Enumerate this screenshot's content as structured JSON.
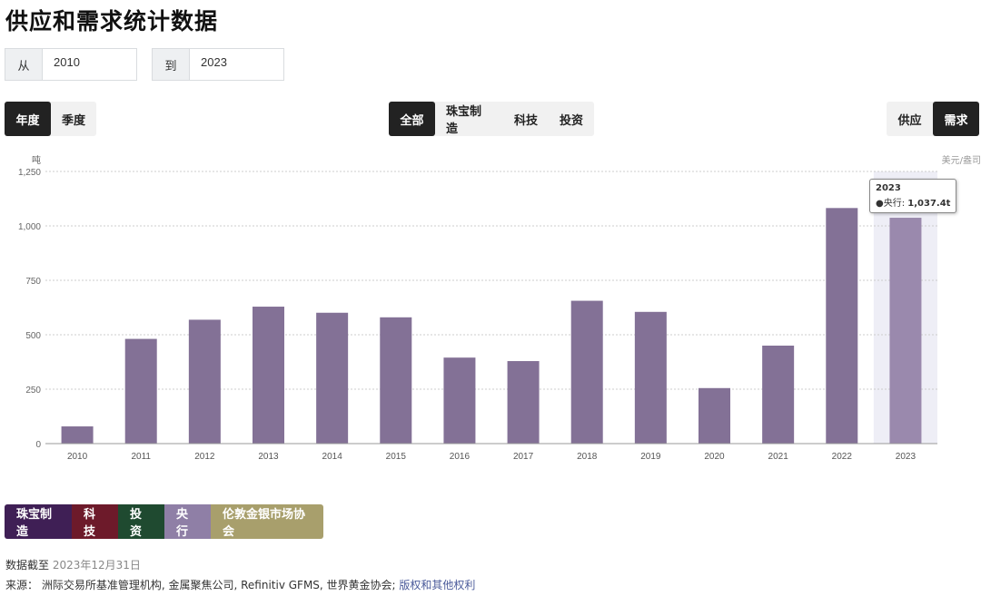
{
  "title": "供应和需求统计数据",
  "range": {
    "from_label": "从",
    "from_value": "2010",
    "to_label": "到",
    "to_value": "2023"
  },
  "period_toggle": {
    "annual": "年度",
    "quarterly": "季度"
  },
  "sector_toggle": {
    "all": "全部",
    "jewellery": "珠宝制造",
    "tech": "科技",
    "investment": "投资"
  },
  "side_toggle": {
    "supply": "供应",
    "demand": "需求"
  },
  "colors": {
    "bar": "#837196",
    "bar_highlight": "#9a89ad",
    "jewellery": "#3f1f55",
    "tech": "#6d1a2a",
    "investment": "#1f4a30",
    "central_banks": "#8f7fa6",
    "lbma": "#a89f6c"
  },
  "chart_data": {
    "type": "bar",
    "categories": [
      "2010",
      "2011",
      "2012",
      "2013",
      "2014",
      "2015",
      "2016",
      "2017",
      "2018",
      "2019",
      "2020",
      "2021",
      "2022",
      "2023"
    ],
    "series": [
      {
        "name": "央行",
        "values": [
          79,
          481,
          569,
          629,
          601,
          580,
          395,
          379,
          656,
          605,
          255,
          450,
          1082,
          1037.4
        ]
      }
    ],
    "ylim": [
      0,
      1250
    ],
    "yticks": [
      "0",
      "250",
      "500",
      "750",
      "1,000",
      "1,250"
    ],
    "ylabel": "吨",
    "y2label": "美元/盎司",
    "grid": true
  },
  "tooltip": {
    "year": "2023",
    "series": "●央行:",
    "value": "1,037.4t"
  },
  "legend": {
    "jewellery": "珠宝制造",
    "tech": "科技",
    "investment": "投资",
    "central_banks": "央行",
    "lbma": "伦敦金银市场协会"
  },
  "footer": {
    "asof_label": "数据截至",
    "asof_date": "2023年12月31日",
    "source_label": "来源：",
    "source_text": "洲际交易所基准管理机构, 金属聚焦公司, Refinitiv GFMS, 世界黄金协会;",
    "rights_link": "版权和其他权利"
  }
}
